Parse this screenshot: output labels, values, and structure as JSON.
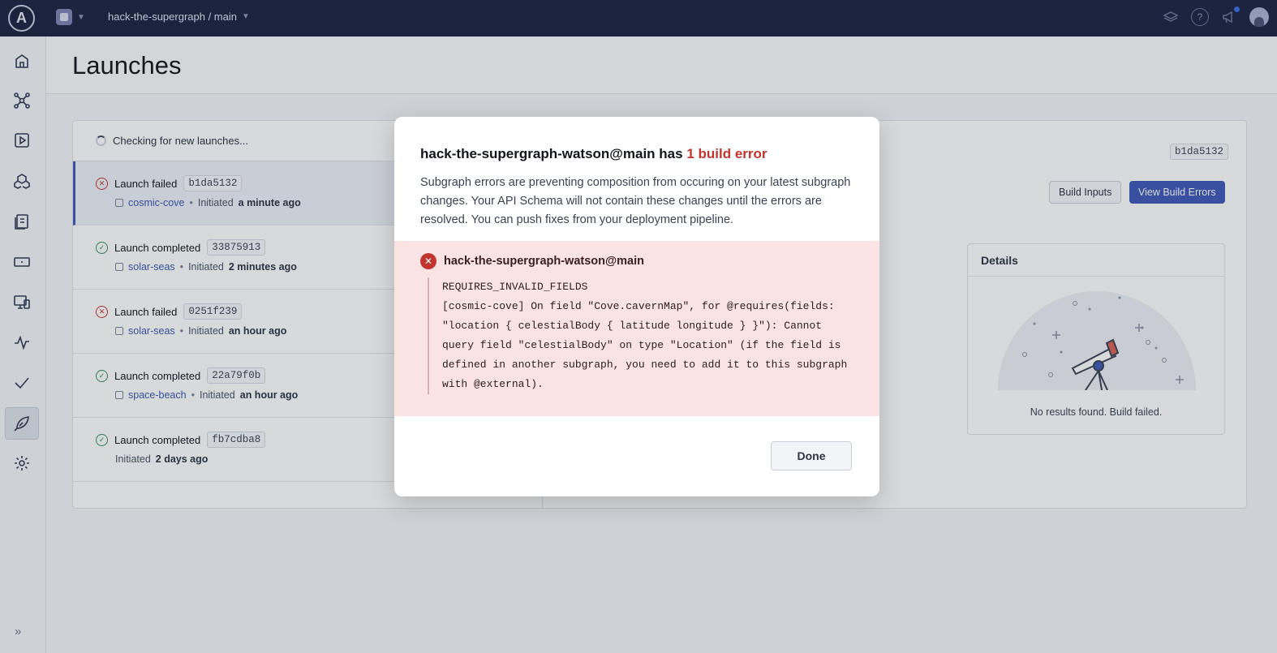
{
  "topbar": {
    "logo_letter": "A",
    "graph_switcher": "hack-the-supergraph / main",
    "icons": [
      "learn-icon",
      "help-icon",
      "announcements-icon",
      "user-avatar"
    ]
  },
  "sidebar": {
    "items": [
      {
        "name": "home-icon"
      },
      {
        "name": "schema-icon"
      },
      {
        "name": "explorer-icon"
      },
      {
        "name": "subgraphs-icon"
      },
      {
        "name": "changelog-icon"
      },
      {
        "name": "clients-icon"
      },
      {
        "name": "operations-icon"
      },
      {
        "name": "insights-icon"
      },
      {
        "name": "checks-icon"
      },
      {
        "name": "launches-icon"
      },
      {
        "name": "settings-icon"
      }
    ]
  },
  "page": {
    "title": "Launches"
  },
  "launches": {
    "checking_text": "Checking for new launches...",
    "items": [
      {
        "status": "Launch failed",
        "hash": "b1da5132",
        "subgraph": "cosmic-cove",
        "initiated_label": "Initiated",
        "time": "a minute ago",
        "ok": false
      },
      {
        "status": "Launch completed",
        "hash": "33875913",
        "subgraph": "solar-seas",
        "initiated_label": "Initiated",
        "time": "2 minutes ago",
        "ok": true
      },
      {
        "status": "Launch failed",
        "hash": "0251f239",
        "subgraph": "solar-seas",
        "initiated_label": "Initiated",
        "time": "an hour ago",
        "ok": false
      },
      {
        "status": "Launch completed",
        "hash": "22a79f0b",
        "subgraph": "space-beach",
        "initiated_label": "Initiated",
        "time": "an hour ago",
        "ok": true
      },
      {
        "status": "Launch completed",
        "hash": "fb7cdba8",
        "subgraph": "",
        "initiated_label": "Initiated",
        "time": "2 days ago",
        "ok": true
      }
    ]
  },
  "detail": {
    "hash": "b1da5132",
    "build_inputs_label": "Build Inputs",
    "view_errors_label": "View Build Errors",
    "details_title": "Details",
    "empty_text": "No results found. Build failed."
  },
  "modal": {
    "title_prefix": "hack-the-supergraph-watson@main has ",
    "title_error": "1 build error",
    "description": "Subgraph errors are preventing composition from occuring on your latest subgraph changes. Your API Schema will not contain these changes until the errors are resolved. You can push fixes from your deployment pipeline.",
    "error_variant": "hack-the-supergraph-watson@main",
    "error_text": "REQUIRES_INVALID_FIELDS\n[cosmic-cove] On field \"Cove.cavernMap\", for @requires(fields:\n\"location { celestialBody { latitude longitude } }\"): Cannot\nquery field \"celestialBody\" on type \"Location\" (if the field is\ndefined in another subgraph, you need to add it to this subgraph\nwith @external).",
    "done_label": "Done"
  },
  "colors": {
    "topbar": "#1b2240",
    "primary": "#3f58b8",
    "error": "#c2352f",
    "success": "#2f8f5a",
    "error_panel": "#fbe3e3"
  }
}
